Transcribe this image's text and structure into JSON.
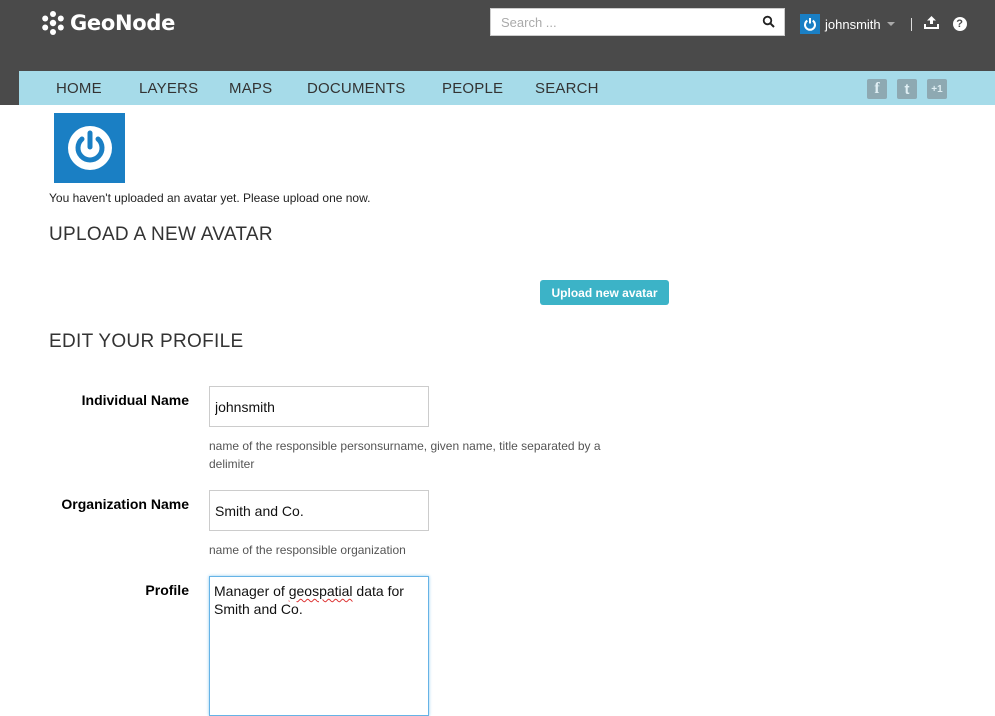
{
  "header": {
    "logo_text": "GeoNode",
    "search_placeholder": "Search ...",
    "username": "johnsmith"
  },
  "nav": {
    "items": [
      "HOME",
      "LAYERS",
      "MAPS",
      "DOCUMENTS",
      "PEOPLE",
      "SEARCH"
    ],
    "social": [
      "facebook-icon",
      "twitter-icon",
      "google-plus-icon"
    ],
    "social_labels": [
      "f",
      "t",
      "+1"
    ]
  },
  "avatar": {
    "message": "You haven't uploaded an avatar yet. Please upload one now."
  },
  "upload_section": {
    "title": "UPLOAD A NEW AVATAR",
    "button_label": "Upload new avatar"
  },
  "profile_section": {
    "title": "EDIT YOUR PROFILE",
    "individual_name": {
      "label": "Individual Name",
      "value": "johnsmith",
      "help": "name of the responsible personsurname, given name, title separated by a delimiter"
    },
    "organization_name": {
      "label": "Organization Name",
      "value": "Smith and Co.",
      "help": "name of the responsible organization"
    },
    "profile": {
      "label": "Profile",
      "value_before": "Manager of ",
      "value_misspelled": "geospatial",
      "value_after": " data for Smith and Co."
    }
  },
  "colors": {
    "topbar": "#4a4a4a",
    "navbar": "#a6dbe9",
    "accent_button": "#3cb3c7",
    "avatar_blue": "#1a7fc4"
  }
}
